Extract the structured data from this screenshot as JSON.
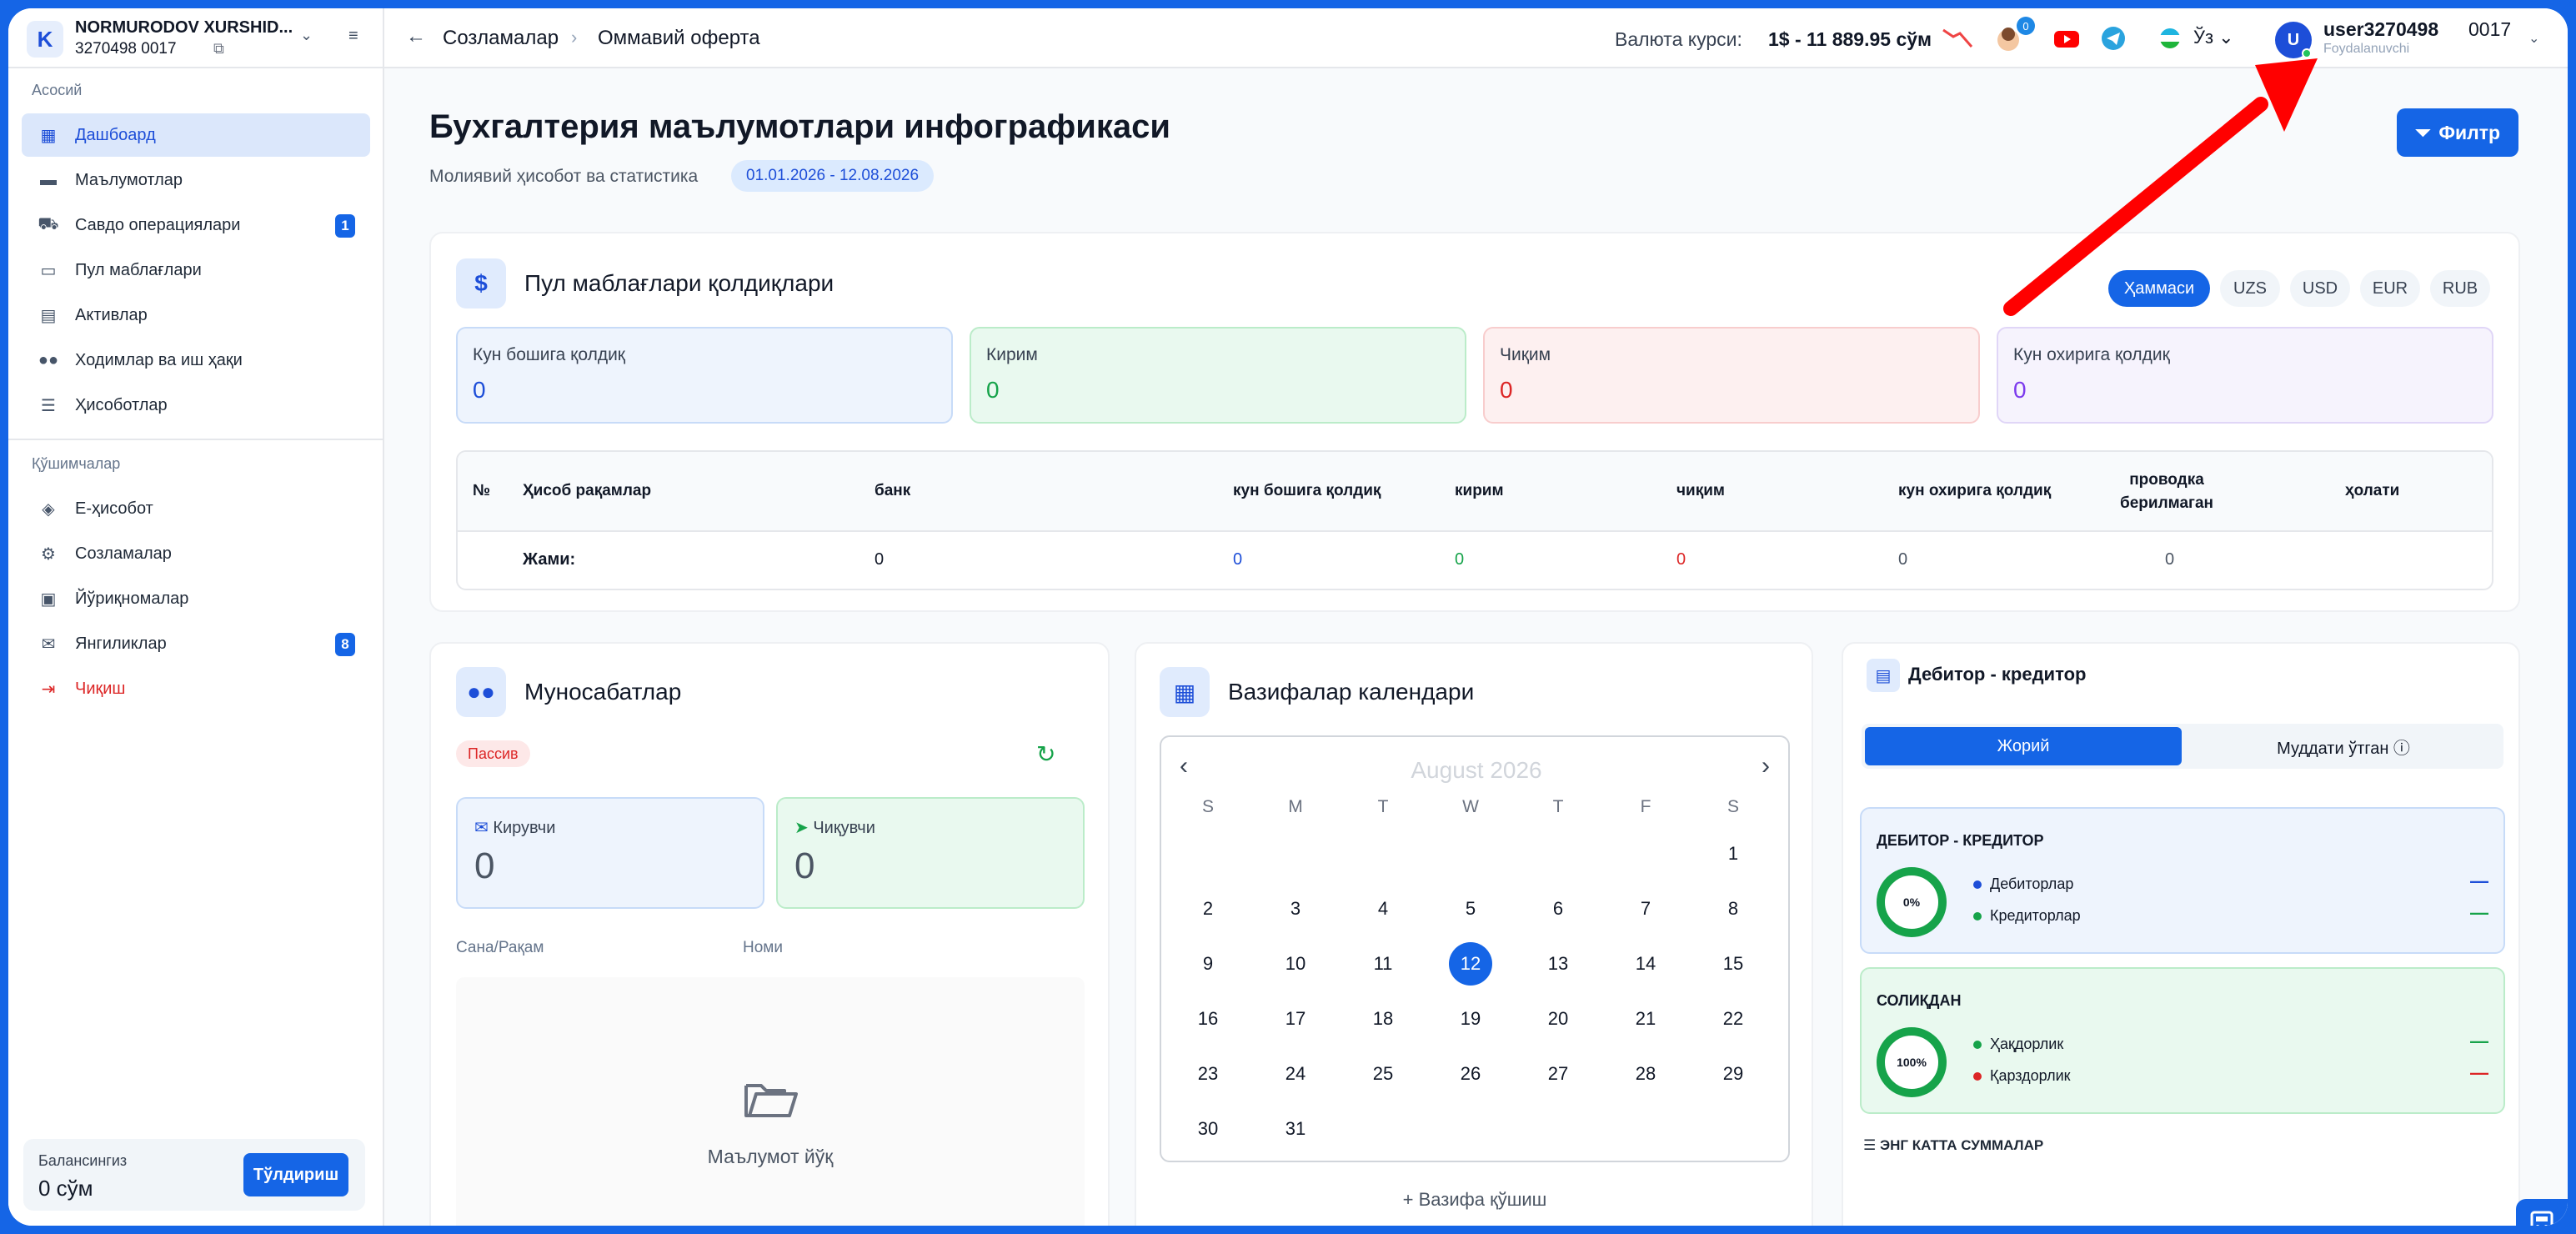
{
  "sidebar": {
    "org_name": "NORMURODOV XURSHID...",
    "org_id": "3270498  0017",
    "sections": {
      "main": "Асосий",
      "extra": "Қўшимчалар"
    },
    "items": [
      {
        "label": "Дашбоард",
        "icon": "dashboard-icon"
      },
      {
        "label": "Маълумотлар",
        "icon": "folder-icon"
      },
      {
        "label": "Савдо операциялари",
        "icon": "truck-icon",
        "badge": "1"
      },
      {
        "label": "Пул маблағлари",
        "icon": "money-icon"
      },
      {
        "label": "Активлар",
        "icon": "building-icon"
      },
      {
        "label": "Ходимлар ва иш ҳақи",
        "icon": "users-icon"
      },
      {
        "label": "Ҳисоботлар",
        "icon": "list-icon"
      }
    ],
    "extra_items": [
      {
        "label": "Е-ҳисобот",
        "icon": "tags-icon"
      },
      {
        "label": "Созламалар",
        "icon": "settings-icon"
      },
      {
        "label": "Йўриқномалар",
        "icon": "book-icon"
      },
      {
        "label": "Янгиликлар",
        "icon": "news-icon",
        "badge": "8"
      },
      {
        "label": "Чиқиш",
        "icon": "logout-icon"
      }
    ],
    "balance": {
      "label": "Балансингиз",
      "value": "0 сўм",
      "button": "Тўлдириш"
    }
  },
  "topbar": {
    "crumb1": "Созламалар",
    "crumb2": "Оммавий оферта",
    "rate_label": "Валюта курси:",
    "rate_value": "1$ - 11 889.95 сўм",
    "notif_count": "0",
    "lang": "Ўз",
    "avatar_letter": "U",
    "username": "user3270498",
    "role": "Foydalanuvchi",
    "code": "0017"
  },
  "page": {
    "title": "Бухгалтерия маълумотлари инфографикаси",
    "subtitle": "Молиявий ҳисобот ва статистика",
    "date_range": "01.01.2026 - 12.08.2026",
    "filter_button": "Филтр"
  },
  "cash": {
    "title": "Пул маблағлари қолдиқлари",
    "tabs": [
      "Ҳаммаси",
      "UZS",
      "USD",
      "EUR",
      "RUB"
    ],
    "stats": [
      {
        "label": "Кун бошига қолдиқ",
        "value": "0",
        "color": "#1d4ed8"
      },
      {
        "label": "Кирим",
        "value": "0",
        "color": "#16a34a"
      },
      {
        "label": "Чиқим",
        "value": "0",
        "color": "#dc2626"
      },
      {
        "label": "Кун охирига қолдиқ",
        "value": "0",
        "color": "#7c3aed"
      }
    ],
    "table": {
      "headers": [
        "№",
        "Ҳисоб рақамлар",
        "банк",
        "кун бошига қолдиқ",
        "кирим",
        "чиқим",
        "кун охирига қолдиқ",
        "проводка берилмаган",
        "ҳолати"
      ],
      "total_label": "Жами:",
      "totals": [
        "0",
        "0",
        "0",
        "0",
        "0",
        "0"
      ]
    }
  },
  "relations": {
    "title": "Муносабатлар",
    "status": "Пассив",
    "incoming": {
      "label": "Кирувчи",
      "value": "0"
    },
    "outgoing": {
      "label": "Чиқувчи",
      "value": "0"
    },
    "col_date": "Сана/Рақам",
    "col_name": "Номи",
    "empty": "Маълумот йўқ"
  },
  "calendar": {
    "title": "Вазифалар календари",
    "month": "August 2026",
    "dow": [
      "S",
      "M",
      "T",
      "W",
      "T",
      "F",
      "S"
    ],
    "days": [
      "1",
      "2",
      "3",
      "4",
      "5",
      "6",
      "7",
      "8",
      "9",
      "10",
      "11",
      "12",
      "13",
      "14",
      "15",
      "16",
      "17",
      "18",
      "19",
      "20",
      "21",
      "22",
      "23",
      "24",
      "25",
      "26",
      "27",
      "28",
      "29",
      "30",
      "31"
    ],
    "first_weekday": 6,
    "today": "12",
    "add_task": "+ Вазифа қўшиш"
  },
  "debitor": {
    "title": "Дебитор - кредитор",
    "tab_current": "Жорий",
    "tab_overdue": "Муддати ўтган ⓘ",
    "box1": {
      "header": "ДЕБИТОР - КРЕДИТОР",
      "percent": "0%",
      "l1": "Дебиторлар",
      "l2": "Кредиторлар"
    },
    "box2": {
      "header": "СОЛИҚДАН",
      "percent": "100%",
      "l1": "Ҳақдорлик",
      "l2": "Қарздорлик"
    },
    "big_sums": "ЭНГ КАТТА СУММАЛАР",
    "dash": "—"
  },
  "colors": {
    "accent": "#1565e6",
    "annotation": "#ff0000"
  }
}
